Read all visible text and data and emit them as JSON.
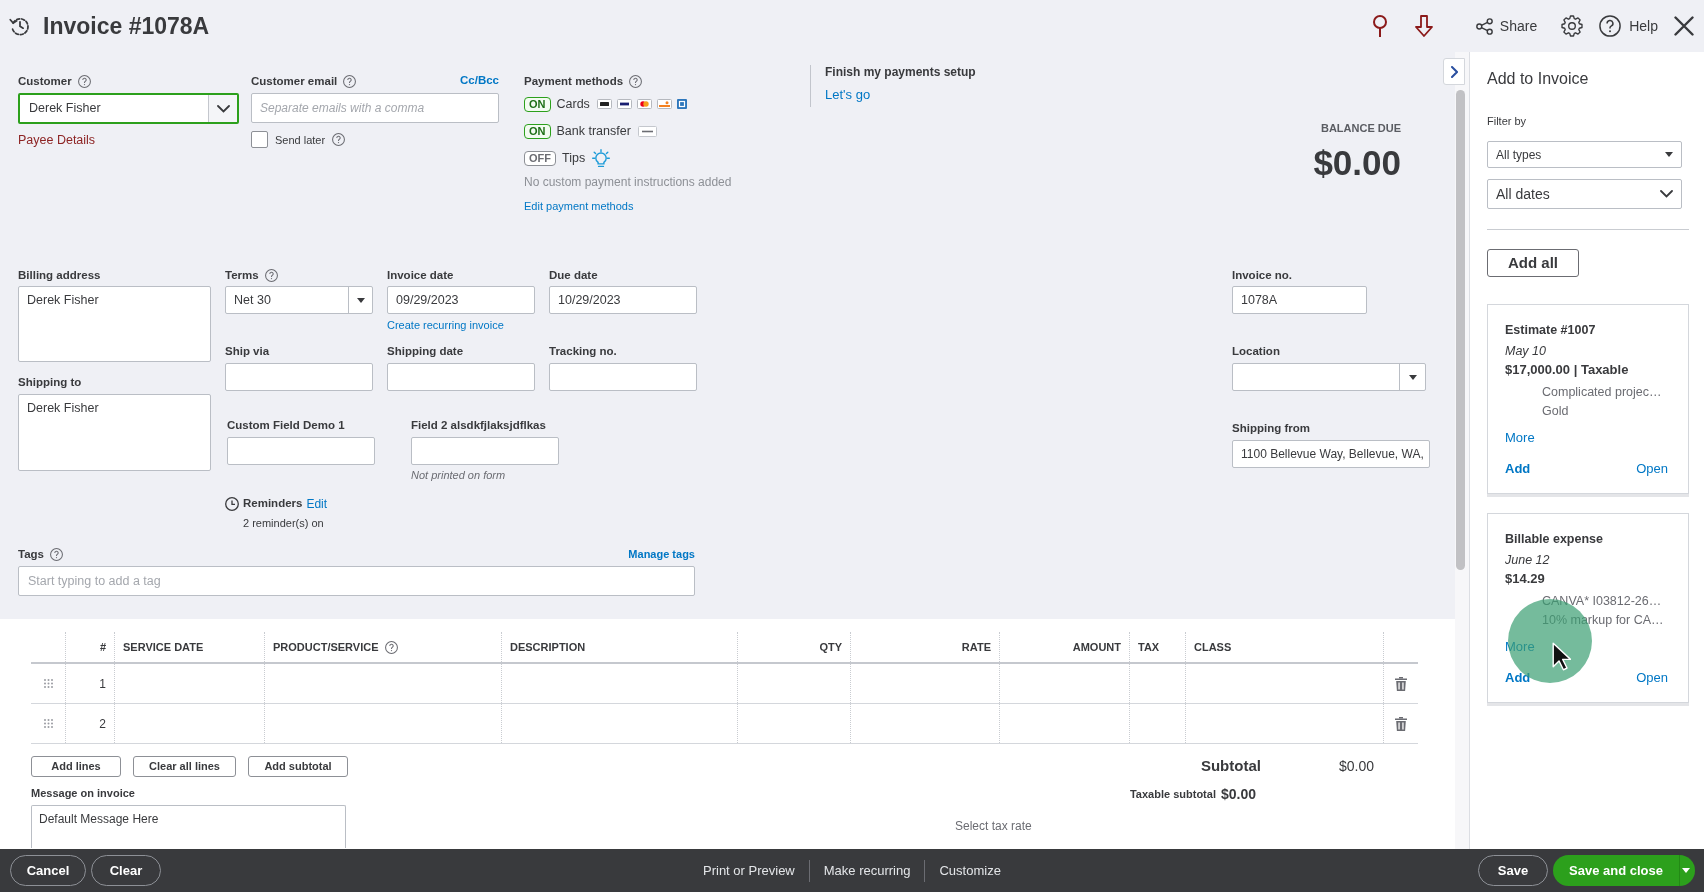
{
  "header": {
    "title": "Invoice #1078A",
    "actions": [
      {
        "kind": "pin"
      },
      {
        "kind": "download"
      },
      {
        "kind": "share",
        "label": "Share"
      },
      {
        "kind": "settings"
      },
      {
        "kind": "help",
        "label": "Help"
      },
      {
        "kind": "close"
      }
    ]
  },
  "customer": {
    "label": "Customer",
    "help": true,
    "value": "Derek Fisher",
    "link": "Payee Details"
  },
  "customer_email": {
    "label": "Customer email",
    "help": true,
    "link": "Cc/Bcc",
    "placeholder": "Separate emails with a comma",
    "send_later": {
      "label": "Send later",
      "checked": false,
      "help": true
    }
  },
  "payment_methods": {
    "label": "Payment methods",
    "help": true,
    "methods": [
      {
        "kind": "cards",
        "on": true,
        "toggle": "ON",
        "name": "Cards"
      },
      {
        "kind": "bank",
        "on": true,
        "toggle": "ON",
        "name": "Bank transfer"
      },
      {
        "kind": "tips",
        "on": false,
        "toggle": "OFF",
        "name": "Tips"
      }
    ],
    "note": "No custom payment instructions added",
    "link": "Edit payment methods"
  },
  "payments_setup": {
    "title": "Finish my payments setup",
    "link": "Let's go"
  },
  "balance_due": {
    "label": "BALANCE DUE",
    "amount": "$0.00"
  },
  "billing_address": {
    "label": "Billing address",
    "value": "Derek Fisher"
  },
  "shipping_to": {
    "label": "Shipping to",
    "value": "Derek Fisher"
  },
  "terms": {
    "label": "Terms",
    "help": true,
    "value": "Net 30"
  },
  "invoice_date": {
    "label": "Invoice date",
    "value": "09/29/2023",
    "link": "Create recurring invoice"
  },
  "due_date": {
    "label": "Due date",
    "value": "10/29/2023"
  },
  "ship_via": {
    "label": "Ship via"
  },
  "shipping_date": {
    "label": "Shipping date"
  },
  "tracking_no": {
    "label": "Tracking no."
  },
  "custom_fields": [
    {
      "label": "Custom Field Demo 1"
    },
    {
      "label": "Field 2 alsdkfjlaksjdflkas",
      "note": "Not printed on form"
    }
  ],
  "reminders": {
    "label": "Reminders",
    "link": "Edit",
    "status": "2 reminder(s) on"
  },
  "tags": {
    "label": "Tags",
    "help": true,
    "link": "Manage tags",
    "placeholder": "Start typing to add a tag"
  },
  "invoice_no": {
    "label": "Invoice no.",
    "value": "1078A"
  },
  "location": {
    "label": "Location"
  },
  "shipping_from": {
    "label": "Shipping from",
    "value": "1100 Bellevue Way, Bellevue, WA,"
  },
  "table": {
    "columns": [
      {
        "label": "#",
        "kind": "number",
        "help": false
      },
      {
        "label": "SERVICE DATE",
        "kind": "text",
        "help": false
      },
      {
        "label": "PRODUCT/SERVICE",
        "kind": "text",
        "help": true
      },
      {
        "label": "DESCRIPTION",
        "kind": "text",
        "help": false
      },
      {
        "label": "QTY",
        "kind": "number",
        "help": false
      },
      {
        "label": "RATE",
        "kind": "number",
        "help": false
      },
      {
        "label": "AMOUNT",
        "kind": "number",
        "help": false
      },
      {
        "label": "TAX",
        "kind": "text",
        "help": false
      },
      {
        "label": "CLASS",
        "kind": "text",
        "help": false
      }
    ],
    "rows": [
      {
        "number": "1"
      },
      {
        "number": "2"
      }
    ]
  },
  "line_buttons": [
    "Add lines",
    "Clear all lines",
    "Add subtotal"
  ],
  "subtotal": {
    "label": "Subtotal",
    "value": "$0.00"
  },
  "taxable_subtotal": {
    "label": "Taxable subtotal",
    "value": "$0.00"
  },
  "tax_rate": {
    "label": "Select tax rate"
  },
  "message": {
    "label": "Message on invoice",
    "value": "Default Message Here"
  },
  "sidebar": {
    "title": "Add to Invoice",
    "filter_label": "Filter by",
    "filters": [
      {
        "kind": "caret",
        "value": "All types"
      },
      {
        "kind": "chevron",
        "value": "All dates"
      }
    ],
    "add_all": "Add all",
    "cards": [
      {
        "title": "Estimate #1007",
        "date": "May 10",
        "amount": "$17,000.00 | Taxable",
        "lines": [
          "Complicated projec…",
          "Gold"
        ],
        "more": "More",
        "add": "Add",
        "open": "Open"
      },
      {
        "title": "Billable expense",
        "date": "June 12",
        "amount": "$14.29",
        "lines": [
          "CANVA* I03812-26…",
          "10% markup for CA…"
        ],
        "more": "More",
        "add": "Add",
        "open": "Open"
      }
    ]
  },
  "footer": {
    "left": [
      "Cancel",
      "Clear"
    ],
    "center": [
      "Print or Preview",
      "Make recurring",
      "Customize"
    ],
    "save": "Save",
    "save_and_close": "Save and close"
  }
}
